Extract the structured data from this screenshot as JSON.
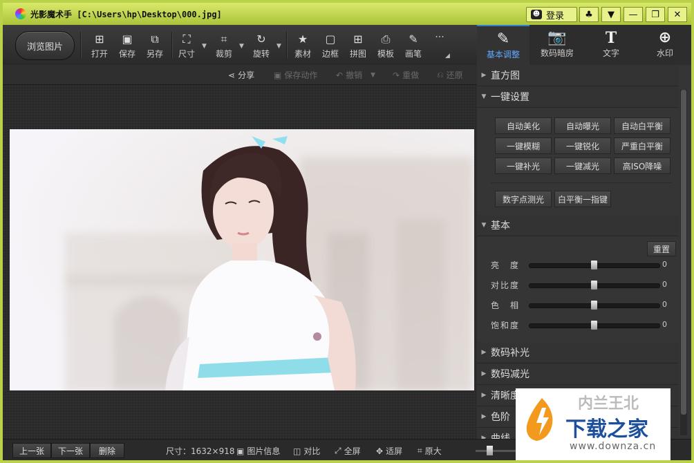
{
  "window": {
    "app_name": "光影魔术手",
    "file_path": "[C:\\Users\\hp\\Desktop\\000.jpg]",
    "login_label": "登录",
    "controls": [
      "▼",
      "—",
      "❐",
      "✕"
    ]
  },
  "toolbar": {
    "browse_label": "浏览图片",
    "tools": [
      {
        "label": "打开",
        "icon": "open-icon"
      },
      {
        "label": "保存",
        "icon": "save-icon"
      },
      {
        "label": "另存",
        "icon": "save-as-icon"
      },
      {
        "label": "尺寸",
        "icon": "resize-icon"
      },
      {
        "label": "裁剪",
        "icon": "crop-icon"
      },
      {
        "label": "旋转",
        "icon": "rotate-icon"
      },
      {
        "label": "素材",
        "icon": "material-icon"
      },
      {
        "label": "边框",
        "icon": "border-icon"
      },
      {
        "label": "拼图",
        "icon": "collage-icon"
      },
      {
        "label": "模板",
        "icon": "template-icon"
      },
      {
        "label": "画笔",
        "icon": "brush-icon"
      }
    ],
    "more_label": "···"
  },
  "right_tabs": [
    {
      "label": "基本调整",
      "icon": "basic-adjust-icon",
      "active": true
    },
    {
      "label": "数码暗房",
      "icon": "camera-icon",
      "active": false
    },
    {
      "label": "文字",
      "icon": "text-icon",
      "active": false
    },
    {
      "label": "水印",
      "icon": "watermark-icon",
      "active": false
    }
  ],
  "subbar": {
    "share": "分享",
    "save_action": "保存动作",
    "undo": "撤销",
    "redo": "重做",
    "restore": "还原"
  },
  "panel": {
    "histogram": "直方图",
    "one_click": "一键设置",
    "one_click_buttons": [
      [
        "自动美化",
        "自动曝光",
        "自动白平衡"
      ],
      [
        "一键模糊",
        "一键锐化",
        "严重白平衡"
      ],
      [
        "一键补光",
        "一键减光",
        "高ISO降噪"
      ]
    ],
    "extra_buttons": [
      "数字点测光",
      "白平衡一指键"
    ],
    "basic": "基本",
    "reset": "重置",
    "sliders": [
      {
        "label": "亮　度",
        "value": "0"
      },
      {
        "label": "对比度",
        "value": "0"
      },
      {
        "label": "色　相",
        "value": "0"
      },
      {
        "label": "饱和度",
        "value": "0"
      }
    ],
    "collapsed_sections": [
      "数码补光",
      "数码减光",
      "清晰度",
      "色阶",
      "曲线"
    ]
  },
  "bottombar": {
    "prev": "上一张",
    "next": "下一张",
    "delete": "删除",
    "size_label": "尺寸：1632×918",
    "info": "图片信息",
    "compare": "对比",
    "fullscreen": "全屏",
    "fit": "适屏",
    "original": "原大"
  },
  "watermark": {
    "title": "下载之家",
    "url": "www.downza.cn",
    "top_text": "内兰王北"
  }
}
